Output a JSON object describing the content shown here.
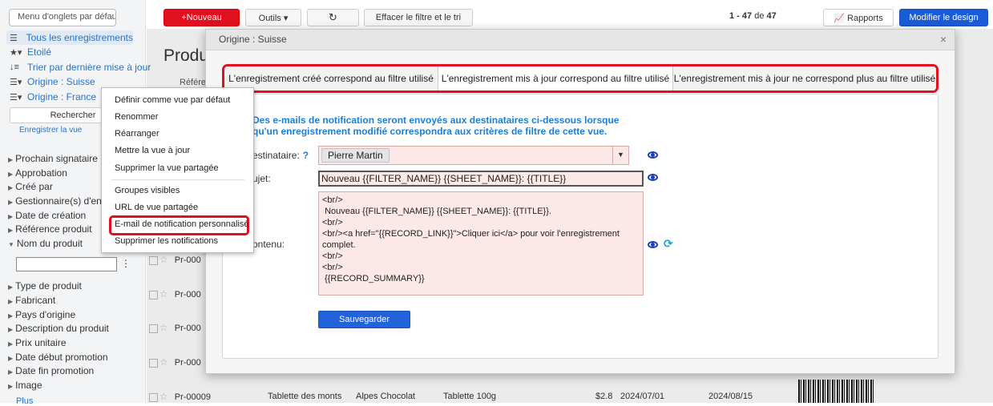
{
  "sidebar": {
    "tab_menu_placeholder": "Menu d'onglets par défaut",
    "views": [
      {
        "label": "Tous les enregistrements",
        "icon": "list-icon"
      },
      {
        "label": "Etoilé",
        "icon": "star-filter-icon"
      },
      {
        "label": "Trier par dernière mise à jour",
        "icon": "sort-icon"
      },
      {
        "label": "Origine : Suisse",
        "icon": "list-filter-icon"
      },
      {
        "label": "Origine : France",
        "icon": "list-filter-icon"
      }
    ],
    "search_label": "Rechercher",
    "save_view_label": "Enregistrer la vue",
    "filters_top": [
      "Prochain signataire",
      "Approbation",
      "Créé par",
      "Gestionnaire(s) d'entrée",
      "Date de création",
      "Référence produit"
    ],
    "filter_open": "Nom du produit",
    "filters_bottom": [
      "Type de produit",
      "Fabricant",
      "Pays d'origine",
      "Description du produit",
      "Prix unitaire",
      "Date début promotion",
      "Date fin promotion",
      "Image"
    ],
    "more_label": "Plus"
  },
  "toolbar": {
    "new_label": "+Nouveau",
    "tools_label": "Outils ▾",
    "refresh_label": "↻",
    "clear_label": "Effacer le filtre et le tri",
    "pager_range": "1 - 47",
    "pager_of": "de",
    "pager_total": "47",
    "reports_label": "Rapports",
    "design_label": "Modifier le design"
  },
  "page": {
    "title_partial": "Produ",
    "ref_header_partial": "Référe",
    "rows_partial": [
      "Pr-000",
      "Pr-000",
      "Pr-000",
      "Pr-000",
      "Pr-000"
    ],
    "last_row": {
      "ref": "Pr-00009",
      "name": "Tablette des monts",
      "maker": "Alpes Chocolat",
      "type": "Tablette 100g",
      "price": "$2.8",
      "start": "2024/07/01",
      "end": "2024/08/15"
    }
  },
  "context_menu": {
    "group1": [
      "Définir comme vue par défaut",
      "Renommer",
      "Réarranger",
      "Mettre la vue à jour",
      "Supprimer la vue partagée"
    ],
    "group2": [
      "Groupes visibles",
      "URL de vue partagée",
      "E-mail de notification personnalisé",
      "Supprimer les notifications"
    ],
    "highlighted": "E-mail de notification personnalisé"
  },
  "modal": {
    "title": "Origine : Suisse",
    "close": "×",
    "tabs": [
      "L'enregistrement créé correspond au filtre utilisé",
      "L'enregistrement mis à jour correspond au filtre utilisé",
      "L'enregistrement mis à jour ne correspond plus au filtre utilisé"
    ],
    "active_tab": 1,
    "info_text": "Des e-mails de notification seront envoyés aux destinataires ci-dessous lorsque qu'un enregistrement modifié correspondra aux critères de filtre de cette vue.",
    "recipient_label": "estinataire:",
    "recipient_help": "?",
    "recipient_value": "Pierre Martin",
    "subject_label": "ujet:",
    "subject_value": "Nouveau {{FILTER_NAME}} {{SHEET_NAME}}: {{TITLE}}",
    "content_label": "ontenu:",
    "content_value": "<br/>\n Nouveau {{FILTER_NAME}} {{SHEET_NAME}}: {{TITLE}}.\n<br/>\n<br/><a href=\"{{RECORD_LINK}}\">Cliquer ici</a> pour voir l'enregistrement complet.\n<br/>\n<br/>\n {{RECORD_SUMMARY}}",
    "save_label": "Sauvegarder"
  },
  "colors": {
    "accent_red": "#e0101e",
    "primary_blue": "#1a5cd6",
    "info_blue": "#1a7fd8"
  }
}
